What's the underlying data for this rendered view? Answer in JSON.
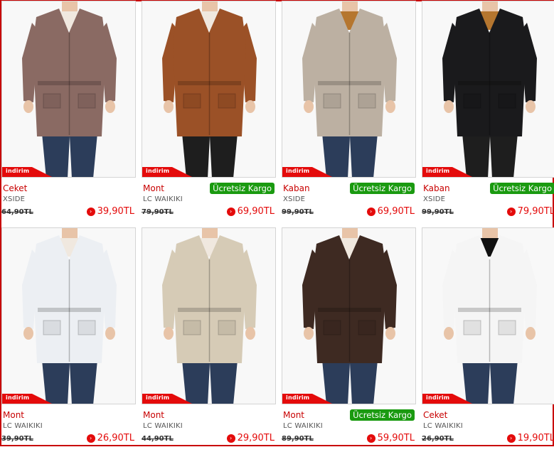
{
  "badge_label": "indirim",
  "colors": {
    "accent": "#e40b0b",
    "kargo_bg": "#1a9a10",
    "frame": "#c80000"
  },
  "products": [
    {
      "category": "Ceket",
      "brand": "XSIDE",
      "old_price": "64,90TL",
      "new_price": "39,90TL",
      "kargo": "",
      "image": "brown-jacket-woman",
      "garment_color": "#8a6a63"
    },
    {
      "category": "Mont",
      "brand": "LC WAIKIKI",
      "old_price": "79,90TL",
      "new_price": "69,90TL",
      "kargo": "Ücretsiz Kargo",
      "image": "leather-jacket-woman",
      "garment_color": "#9b5127"
    },
    {
      "category": "Kaban",
      "brand": "XSIDE",
      "old_price": "99,90TL",
      "new_price": "69,90TL",
      "kargo": "Ücretsiz Kargo",
      "image": "beige-parka-woman",
      "garment_color": "#bcb0a2"
    },
    {
      "category": "Kaban",
      "brand": "XSIDE",
      "old_price": "99,90TL",
      "new_price": "79,90TL",
      "kargo": "Ücretsiz Kargo",
      "image": "black-parka-woman",
      "garment_color": "#1a1a1c"
    },
    {
      "category": "Mont",
      "brand": "LC WAIKIKI",
      "old_price": "39,90TL",
      "new_price": "26,90TL",
      "kargo": "",
      "image": "white-jacket-woman",
      "garment_color": "#eceff3"
    },
    {
      "category": "Mont",
      "brand": "LC WAIKIKI",
      "old_price": "44,90TL",
      "new_price": "29,90TL",
      "kargo": "",
      "image": "cream-jacket-woman",
      "garment_color": "#d6cbb6"
    },
    {
      "category": "Mont",
      "brand": "LC WAIKIKI",
      "old_price": "89,90TL",
      "new_price": "59,90TL",
      "kargo": "Ücretsiz Kargo",
      "image": "dark-leather-jacket-woman",
      "garment_color": "#3e2a22"
    },
    {
      "category": "Ceket",
      "brand": "LC WAIKIKI",
      "old_price": "26,90TL",
      "new_price": "19,90TL",
      "kargo": "",
      "image": "white-bolero-woman",
      "garment_color": "#f5f5f5"
    }
  ]
}
